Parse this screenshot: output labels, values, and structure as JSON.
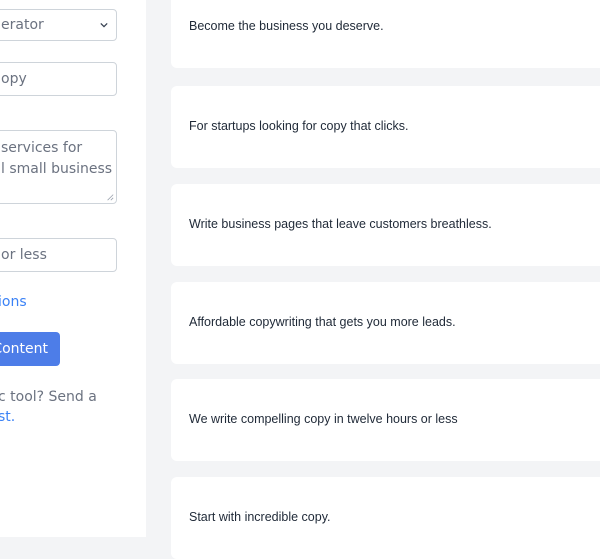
{
  "sidebar": {
    "tool_select": {
      "value": "erator"
    },
    "copy_type_input": {
      "value": "opy"
    },
    "description_textarea": {
      "line1": "services for",
      "line2": "l small business"
    },
    "length_input": {
      "value": "or less"
    },
    "options_link": "ions",
    "generate_button": "Content",
    "help_text": "c tool? Send a",
    "help_link": "st."
  },
  "results": [
    "Become the business you deserve.",
    "For startups looking for copy that clicks.",
    "Write business pages that leave customers breathless.",
    "Affordable copywriting that gets you more leads.",
    "We write compelling copy in twelve hours or less",
    "Start with incredible copy."
  ],
  "colors": {
    "accent": "#4d7de8",
    "link": "#3b82f6",
    "background": "#f3f4f6"
  }
}
